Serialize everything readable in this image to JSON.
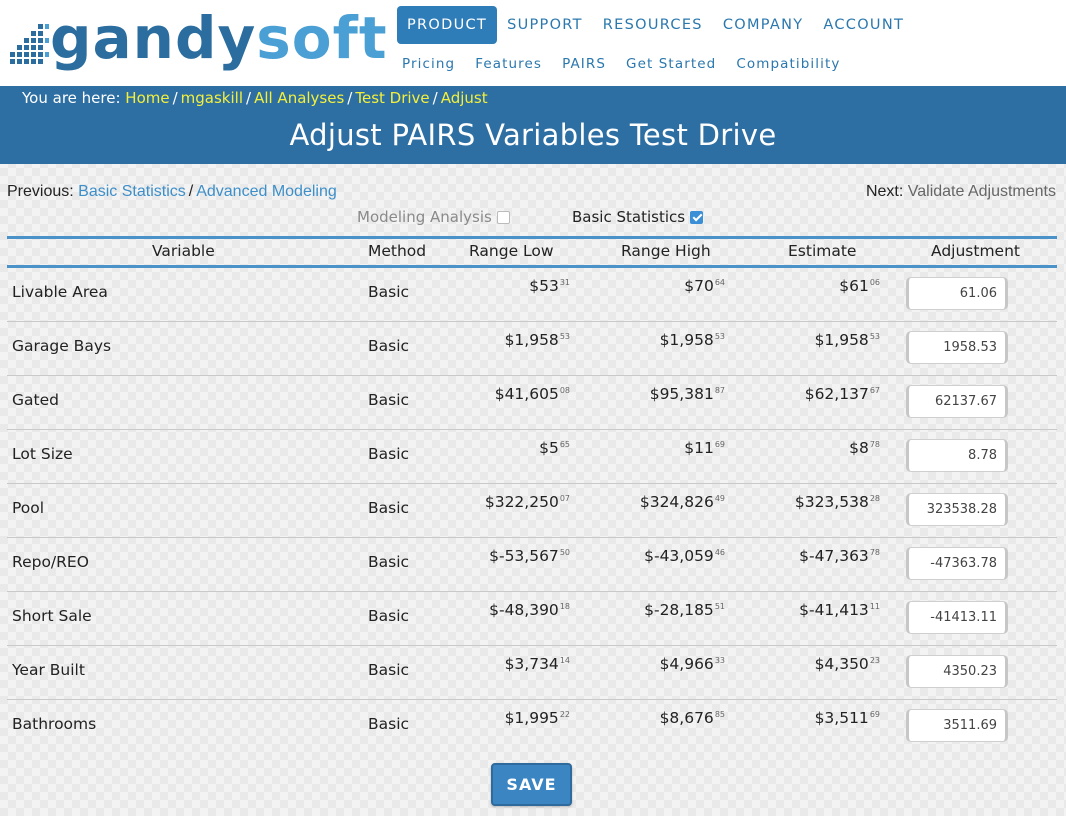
{
  "logo": {
    "text_part1": "gandy",
    "text_part2": "soft"
  },
  "nav": {
    "main": [
      {
        "label": "PRODUCT",
        "active": true
      },
      {
        "label": "SUPPORT",
        "active": false
      },
      {
        "label": "RESOURCES",
        "active": false
      },
      {
        "label": "COMPANY",
        "active": false
      },
      {
        "label": "ACCOUNT",
        "active": false
      }
    ],
    "sub": [
      "Pricing",
      "Features",
      "PAIRS",
      "Get Started",
      "Compatibility"
    ]
  },
  "breadcrumb": {
    "prefix": "You are here:",
    "items": [
      "Home",
      "mgaskill",
      "All Analyses",
      "Test Drive",
      "Adjust"
    ],
    "separator": "/"
  },
  "page_title": "Adjust PAIRS Variables Test Drive",
  "previous": {
    "label": "Previous:",
    "links": [
      "Basic Statistics",
      "Advanced Modeling"
    ],
    "separator": "/"
  },
  "next": {
    "label": "Next:",
    "link": "Validate Adjustments"
  },
  "toggles": {
    "modeling": {
      "label": "Modeling Analysis",
      "checked": false
    },
    "basic": {
      "label": "Basic Statistics",
      "checked": true
    }
  },
  "table": {
    "headers": {
      "variable": "Variable",
      "method": "Method",
      "range_low": "Range Low",
      "range_high": "Range High",
      "estimate": "Estimate",
      "adjustment": "Adjustment"
    },
    "rows": [
      {
        "variable": "Livable Area",
        "method": "Basic",
        "low": {
          "main": "$53",
          "cents": "31"
        },
        "high": {
          "main": "$70",
          "cents": "64"
        },
        "est": {
          "main": "$61",
          "cents": "06"
        },
        "adjustment": "61.06"
      },
      {
        "variable": "Garage Bays",
        "method": "Basic",
        "low": {
          "main": "$1,958",
          "cents": "53"
        },
        "high": {
          "main": "$1,958",
          "cents": "53"
        },
        "est": {
          "main": "$1,958",
          "cents": "53"
        },
        "adjustment": "1958.53"
      },
      {
        "variable": "Gated",
        "method": "Basic",
        "low": {
          "main": "$41,605",
          "cents": "08"
        },
        "high": {
          "main": "$95,381",
          "cents": "87"
        },
        "est": {
          "main": "$62,137",
          "cents": "67"
        },
        "adjustment": "62137.67"
      },
      {
        "variable": "Lot Size",
        "method": "Basic",
        "low": {
          "main": "$5",
          "cents": "65"
        },
        "high": {
          "main": "$11",
          "cents": "69"
        },
        "est": {
          "main": "$8",
          "cents": "78"
        },
        "adjustment": "8.78"
      },
      {
        "variable": "Pool",
        "method": "Basic",
        "low": {
          "main": "$322,250",
          "cents": "07"
        },
        "high": {
          "main": "$324,826",
          "cents": "49"
        },
        "est": {
          "main": "$323,538",
          "cents": "28"
        },
        "adjustment": "323538.28"
      },
      {
        "variable": "Repo/REO",
        "method": "Basic",
        "low": {
          "main": "$-53,567",
          "cents": "50"
        },
        "high": {
          "main": "$-43,059",
          "cents": "46"
        },
        "est": {
          "main": "$-47,363",
          "cents": "78"
        },
        "adjustment": "-47363.78"
      },
      {
        "variable": "Short Sale",
        "method": "Basic",
        "low": {
          "main": "$-48,390",
          "cents": "18"
        },
        "high": {
          "main": "$-28,185",
          "cents": "51"
        },
        "est": {
          "main": "$-41,413",
          "cents": "11"
        },
        "adjustment": "-41413.11"
      },
      {
        "variable": "Year Built",
        "method": "Basic",
        "low": {
          "main": "$3,734",
          "cents": "14"
        },
        "high": {
          "main": "$4,966",
          "cents": "33"
        },
        "est": {
          "main": "$4,350",
          "cents": "23"
        },
        "adjustment": "4350.23"
      },
      {
        "variable": "Bathrooms",
        "method": "Basic",
        "low": {
          "main": "$1,995",
          "cents": "22"
        },
        "high": {
          "main": "$8,676",
          "cents": "85"
        },
        "est": {
          "main": "$3,511",
          "cents": "69"
        },
        "adjustment": "3511.69"
      }
    ]
  },
  "save_button": {
    "label": "SAVE"
  },
  "colors": {
    "brand_dark": "#2b6d9e",
    "brand_light": "#4a9fd4",
    "banner": "#2e6fa3",
    "breadcrumb_link": "#f4f03a",
    "link": "#3d8fc9",
    "active_nav": "#2e7db8"
  }
}
